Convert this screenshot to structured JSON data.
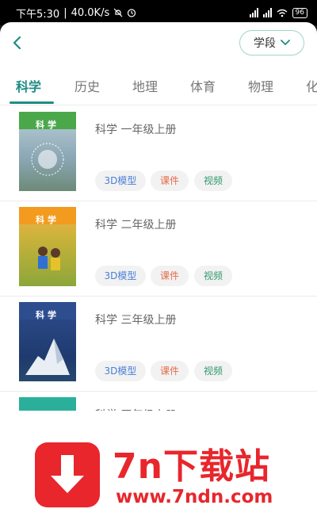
{
  "status_bar": {
    "time": "下午5:30",
    "net_speed": "40.0K/s",
    "battery": "96"
  },
  "header": {
    "filter_label": "学段"
  },
  "tabs": [
    {
      "label": "科学",
      "active": true
    },
    {
      "label": "历史",
      "active": false
    },
    {
      "label": "地理",
      "active": false
    },
    {
      "label": "体育",
      "active": false
    },
    {
      "label": "物理",
      "active": false
    },
    {
      "label": "化",
      "active": false
    }
  ],
  "books": [
    {
      "title": "科学 一年级上册",
      "cover_title": "科学",
      "cover_color": "#4aa84a"
    },
    {
      "title": "科学 二年级上册",
      "cover_title": "科学",
      "cover_color": "#f29b1e"
    },
    {
      "title": "科学 三年级上册",
      "cover_title": "科学",
      "cover_color": "#2e4d8f"
    },
    {
      "title": "科学 四年级上册",
      "cover_title": "",
      "cover_color": "#2ab09a"
    }
  ],
  "chips": {
    "model": "3D模型",
    "courseware": "课件",
    "video": "视频"
  },
  "watermark": {
    "name": "7n下载站",
    "url": "www.7ndn.com"
  },
  "colors": {
    "accent": "#1e8c84",
    "chip_model": "#4a7fd6",
    "chip_course": "#e56b4b",
    "chip_video": "#2f9a6a",
    "watermark_red": "#e8262c"
  }
}
